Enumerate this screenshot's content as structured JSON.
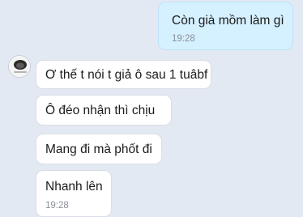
{
  "conversation": {
    "messages": [
      {
        "direction": "outgoing",
        "text": "Còn già mồm làm gì",
        "time": "19:28"
      },
      {
        "direction": "incoming",
        "text": "Ơ thế t nói t giả ô sau 1 tuâbf",
        "time": ""
      },
      {
        "direction": "incoming",
        "text": "Ô đéo nhận thì chịu",
        "time": ""
      },
      {
        "direction": "incoming",
        "text": "Mang đi mà phốt đi",
        "time": ""
      },
      {
        "direction": "incoming",
        "text": "Nhanh lên",
        "time": "19:28"
      }
    ]
  },
  "colors": {
    "background": "#e3e9f2",
    "outgoing_bubble": "#d5f0ff",
    "incoming_bubble": "#ffffff",
    "timestamp": "#8a9099"
  }
}
